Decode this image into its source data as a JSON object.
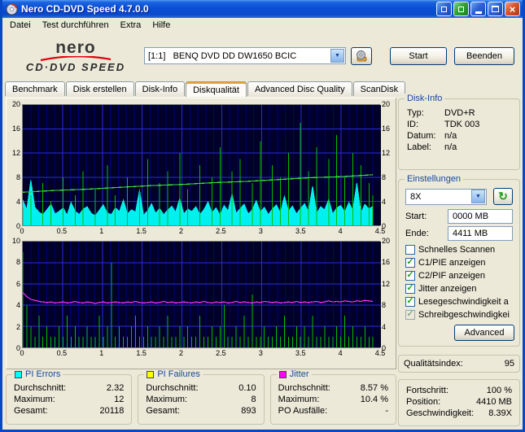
{
  "window": {
    "title": "Nero CD-DVD Speed 4.7.0.0",
    "menu": [
      "Datei",
      "Test durchführen",
      "Extra",
      "Hilfe"
    ],
    "logo": {
      "brand": "nero",
      "product": "CD·DVD SPEED"
    },
    "drive_select": {
      "value": "[1:1]   BENQ DVD DD DW1650 BCIC"
    },
    "buttons": {
      "start": "Start",
      "quit": "Beenden"
    },
    "tabs": [
      {
        "label": "Benchmark",
        "active": false
      },
      {
        "label": "Disk erstellen",
        "active": false
      },
      {
        "label": "Disk-Info",
        "active": false
      },
      {
        "label": "Diskqualität",
        "active": true
      },
      {
        "label": "Advanced Disc Quality",
        "active": false
      },
      {
        "label": "ScanDisk",
        "active": false
      }
    ]
  },
  "icons": {
    "close": "×",
    "dropdown": "▼",
    "refresh": "↻",
    "check": "✓"
  },
  "disk_info": {
    "title": "Disk-Info",
    "rows": [
      [
        "Typ:",
        "DVD+R"
      ],
      [
        "ID:",
        "TDK 003"
      ],
      [
        "Datum:",
        "n/a"
      ],
      [
        "Label:",
        "n/a"
      ]
    ]
  },
  "settings": {
    "title": "Einstellungen",
    "speed_value": "8X",
    "start_label": "Start:",
    "start_value": "0000 MB",
    "end_label": "Ende:",
    "end_value": "4411 MB",
    "checkboxes": [
      {
        "label": "Schnelles Scannen",
        "checked": false,
        "disabled": false
      },
      {
        "label": "C1/PIE anzeigen",
        "checked": true,
        "disabled": false
      },
      {
        "label": "C2/PIF anzeigen",
        "checked": true,
        "disabled": false
      },
      {
        "label": "Jitter anzeigen",
        "checked": true,
        "disabled": false
      },
      {
        "label": "Lesegeschwindigkeit a",
        "checked": true,
        "disabled": false
      },
      {
        "label": "Schreibgeschwindigkei",
        "checked": true,
        "disabled": true
      }
    ],
    "advanced_label": "Advanced"
  },
  "quality_index": {
    "label": "Qualitätsindex:",
    "value": "95"
  },
  "progress": {
    "rows": [
      [
        "Fortschritt:",
        "100 %"
      ],
      [
        "Position:",
        "4410 MB"
      ],
      [
        "Geschwindigkeit:",
        "8.39X"
      ]
    ]
  },
  "stats": [
    {
      "title": "PI Errors",
      "color": "#00FFFF",
      "rows": [
        [
          "Durchschnitt:",
          "2.32"
        ],
        [
          "Maximum:",
          "12"
        ],
        [
          "Gesamt:",
          "20118"
        ]
      ]
    },
    {
      "title": "PI Failures",
      "color": "#FFFF00",
      "rows": [
        [
          "Durchschnitt:",
          "0.10"
        ],
        [
          "Maximum:",
          "8"
        ],
        [
          "Gesamt:",
          "893"
        ]
      ]
    },
    {
      "title": "Jitter",
      "color": "#FF00FF",
      "rows": [
        [
          "Durchschnitt:",
          "8.57 %"
        ],
        [
          "Maximum:",
          "10.4 %"
        ],
        [
          "PO Ausfälle:",
          "-"
        ]
      ]
    }
  ],
  "chart_data": [
    {
      "type": "area",
      "name": "PI Errors scan graph",
      "x_range": [
        0,
        4.5
      ],
      "x_ticks": [
        "0",
        "0.5",
        "1",
        "1.5",
        "2",
        "2.5",
        "3",
        "3.5",
        "4",
        "4.5"
      ],
      "y_left": {
        "range": [
          0,
          20
        ],
        "ticks": [
          "20",
          "16",
          "12",
          "8",
          "4",
          "0"
        ]
      },
      "y_right": {
        "range": [
          0,
          20
        ],
        "ticks": [
          "20",
          "16",
          "12",
          "8",
          "4",
          "0"
        ]
      },
      "series": [
        {
          "name": "C1/PIE errors",
          "style": "area",
          "color": "#00F0F0",
          "axis": "left",
          "x_end": 4.4,
          "values": [
            4.2,
            2.6,
            7.5,
            3.0,
            2.2,
            1.8,
            2.6,
            3.5,
            1.9,
            2.3,
            2.9,
            1.7,
            3.8,
            2.4,
            1.8,
            2.7,
            3.1,
            2.0,
            1.6,
            2.5,
            3.4,
            2.1,
            1.8,
            2.9,
            2.3,
            4.2,
            1.9,
            2.6,
            2.2,
            5.8,
            1.7,
            2.4,
            3.6,
            2.0,
            2.8,
            1.8,
            2.5,
            3.2,
            2.2,
            4.5,
            1.9,
            2.7,
            2.3,
            3.1,
            1.8,
            2.6,
            3.9,
            2.1,
            2.9,
            1.7,
            3.3,
            2.4,
            5.2,
            2.0,
            2.8,
            3.5,
            1.9,
            2.6,
            4.1,
            2.2,
            3.0,
            1.8,
            2.7,
            3.4,
            2.1,
            4.8,
            2.4,
            3.2,
            1.9,
            2.8,
            3.6,
            2.3,
            6.5,
            2.0,
            3.1,
            2.6,
            4.3,
            1.9,
            2.9,
            3.3,
            2.2,
            3.8,
            2.5,
            7.0,
            2.1,
            3.5,
            2.7,
            3.2
          ]
        },
        {
          "name": "PIE peaks",
          "style": "spikes",
          "color": "#00C000",
          "axis": "left",
          "x_end": 4.4,
          "values": [
            3,
            0,
            5,
            0,
            0,
            7,
            0,
            4,
            0,
            0,
            8,
            0,
            0,
            5,
            0,
            9,
            0,
            0,
            6,
            0,
            0,
            10,
            0,
            5,
            0,
            0,
            8,
            0,
            0,
            6,
            0,
            11,
            0,
            0,
            7,
            0,
            9,
            0,
            0,
            12,
            0,
            6,
            0,
            0,
            10,
            0,
            0,
            8,
            0,
            13,
            0,
            0,
            9,
            0,
            11,
            0,
            0,
            7,
            0,
            14,
            0,
            0,
            10,
            0,
            8,
            0,
            12,
            0,
            0,
            17,
            0,
            9,
            0,
            13,
            0,
            0,
            11,
            0,
            15,
            0,
            8,
            0,
            12,
            0,
            10,
            0,
            7,
            5
          ]
        },
        {
          "name": "Lesegeschwindigkeit",
          "style": "line",
          "color": "#3CDC3C",
          "axis": "right",
          "x_end": 4.4,
          "values": [
            5.5,
            5.8,
            6.0,
            6.3,
            6.6,
            6.8,
            7.1,
            7.3,
            7.6,
            7.9,
            8.1,
            8.4
          ]
        }
      ]
    },
    {
      "type": "line",
      "name": "PI Failures and Jitter graph",
      "x_range": [
        0,
        4.5
      ],
      "x_ticks": [
        "0",
        "0.5",
        "1",
        "1.5",
        "2",
        "2.5",
        "3",
        "3.5",
        "4",
        "4.5"
      ],
      "y_left": {
        "range": [
          0,
          10
        ],
        "ticks": [
          "10",
          "8",
          "6",
          "4",
          "2",
          "0"
        ]
      },
      "y_right": {
        "range": [
          0,
          20
        ],
        "ticks": [
          "20",
          "16",
          "12",
          "8",
          "4",
          "0"
        ]
      },
      "series": [
        {
          "name": "C2/PIF failures",
          "style": "spikes",
          "color": "#00C000",
          "axis": "left",
          "x_end": 4.4,
          "values": [
            9,
            4,
            2,
            1,
            3,
            1,
            2,
            1,
            1,
            2,
            1,
            3,
            1,
            2,
            1,
            1,
            2,
            1,
            1,
            3,
            1,
            2,
            8,
            1,
            2,
            1,
            1,
            2,
            3,
            1,
            1,
            2,
            1,
            1,
            2,
            1,
            3,
            1,
            1,
            2,
            1,
            2,
            1,
            1,
            3,
            1,
            1,
            2,
            1,
            2,
            4,
            1,
            1,
            2,
            1,
            3,
            1,
            5,
            1,
            1,
            2,
            1,
            1,
            2,
            1,
            3,
            1,
            1,
            2,
            1,
            2,
            1,
            3,
            1,
            1,
            2,
            1,
            1,
            2,
            1,
            3,
            1,
            2,
            1,
            1,
            2,
            1,
            1
          ]
        },
        {
          "name": "Jitter",
          "style": "line",
          "color": "#FF30FF",
          "axis": "right",
          "x_end": 4.4,
          "values": [
            10.4,
            9.6,
            9.1,
            8.9,
            8.7,
            8.6,
            8.5,
            8.6,
            8.4,
            8.5,
            8.6,
            8.4,
            8.5,
            8.7,
            8.5,
            8.4,
            8.6,
            8.5,
            8.3,
            8.5,
            8.6,
            8.4,
            8.5,
            8.6,
            8.5,
            8.4,
            8.6,
            8.5,
            8.7,
            8.5,
            8.4,
            8.5,
            8.6,
            8.4,
            8.5,
            8.7,
            8.5,
            8.6,
            8.4,
            8.5,
            8.6,
            8.5,
            8.4,
            8.6,
            8.5,
            8.7,
            8.5,
            8.4,
            8.6,
            8.5,
            8.6,
            8.4,
            8.5,
            8.7,
            8.5,
            8.6,
            8.5,
            8.4,
            8.6,
            8.5,
            8.7,
            8.6,
            8.5,
            8.6,
            8.4,
            8.5,
            8.6,
            8.5,
            8.7,
            8.5,
            8.6,
            8.5,
            8.6,
            8.7,
            8.5,
            8.6,
            8.8,
            8.6,
            8.7,
            8.6,
            8.8,
            8.7,
            8.6,
            8.8,
            8.7,
            8.9,
            8.8,
            8.7
          ]
        }
      ]
    }
  ]
}
